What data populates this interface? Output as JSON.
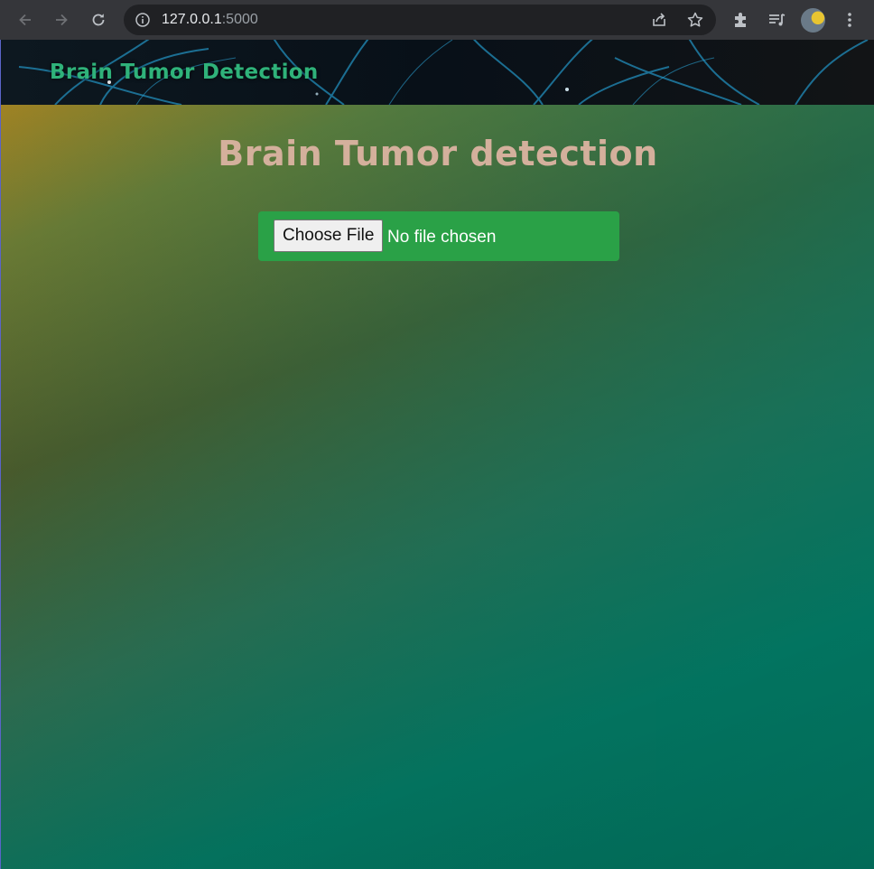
{
  "browser": {
    "url_host": "127.0.0.1",
    "url_port": ":5000",
    "icons": {
      "back": "back-arrow-icon",
      "forward": "forward-arrow-icon",
      "reload": "reload-icon",
      "info": "info-icon",
      "share": "share-icon",
      "bookmark": "star-icon",
      "extensions": "puzzle-icon",
      "reading_list": "reading-list-icon",
      "menu": "kebab-menu-icon"
    }
  },
  "header": {
    "title": "Brain Tumor Detection",
    "title_color": "#2fb27a"
  },
  "main": {
    "heading": "Brain Tumor detection",
    "heading_color": "#d4b09c",
    "upload": {
      "button_label": "Choose File",
      "status": "No file chosen",
      "box_color": "#2aa147"
    }
  }
}
